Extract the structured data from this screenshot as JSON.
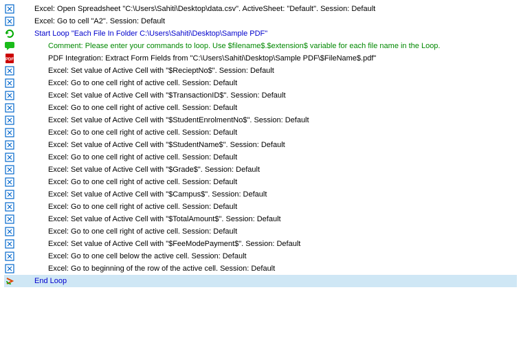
{
  "lines": [
    {
      "icon": "excel",
      "indent": 1,
      "color": "black",
      "text": "Excel: Open Spreadsheet \"C:\\Users\\Sahiti\\Desktop\\data.csv\". ActiveSheet: \"Default\". Session: Default"
    },
    {
      "icon": "excel",
      "indent": 1,
      "color": "black",
      "text": "Excel: Go to cell \"A2\". Session: Default"
    },
    {
      "icon": "loop-start",
      "indent": 1,
      "color": "blue",
      "text": "Start Loop \"Each File In Folder C:\\Users\\Sahiti\\Desktop\\Sample PDF\""
    },
    {
      "icon": "comment",
      "indent": 2,
      "color": "green",
      "text": "Comment: Please enter your commands to loop. Use $filename$.$extension$ variable for each file name in the Loop."
    },
    {
      "icon": "pdf",
      "indent": 2,
      "color": "black",
      "text": "PDF Integration: Extract Form Fields from \"C:\\Users\\Sahiti\\Desktop\\Sample PDF\\$FileName$.pdf\""
    },
    {
      "icon": "excel",
      "indent": 2,
      "color": "black",
      "text": "Excel: Set value of Active Cell with \"$RecieptNo$\". Session: Default"
    },
    {
      "icon": "excel",
      "indent": 2,
      "color": "black",
      "text": "Excel: Go to one cell right of active cell. Session: Default"
    },
    {
      "icon": "excel",
      "indent": 2,
      "color": "black",
      "text": "Excel: Set value of Active Cell with \"$TransactionID$\". Session: Default"
    },
    {
      "icon": "excel",
      "indent": 2,
      "color": "black",
      "text": "Excel: Go to one cell right of active cell. Session: Default"
    },
    {
      "icon": "excel",
      "indent": 2,
      "color": "black",
      "text": "Excel: Set value of Active Cell with \"$StudentEnrolmentNo$\". Session: Default"
    },
    {
      "icon": "excel",
      "indent": 2,
      "color": "black",
      "text": "Excel: Go to one cell right of active cell. Session: Default"
    },
    {
      "icon": "excel",
      "indent": 2,
      "color": "black",
      "text": "Excel: Set value of Active Cell with \"$StudentName$\". Session: Default"
    },
    {
      "icon": "excel",
      "indent": 2,
      "color": "black",
      "text": "Excel: Go to one cell right of active cell. Session: Default"
    },
    {
      "icon": "excel",
      "indent": 2,
      "color": "black",
      "text": "Excel: Set value of Active Cell with \"$Grade$\". Session: Default"
    },
    {
      "icon": "excel",
      "indent": 2,
      "color": "black",
      "text": "Excel: Go to one cell right of active cell. Session: Default"
    },
    {
      "icon": "excel",
      "indent": 2,
      "color": "black",
      "text": "Excel: Set value of Active Cell with \"$Campus$\". Session: Default"
    },
    {
      "icon": "excel",
      "indent": 2,
      "color": "black",
      "text": "Excel: Go to one cell right of active cell. Session: Default"
    },
    {
      "icon": "excel",
      "indent": 2,
      "color": "black",
      "text": "Excel: Set value of Active Cell with \"$TotalAmount$\". Session: Default"
    },
    {
      "icon": "excel",
      "indent": 2,
      "color": "black",
      "text": "Excel: Go to one cell right of active cell. Session: Default"
    },
    {
      "icon": "excel",
      "indent": 2,
      "color": "black",
      "text": "Excel: Set value of Active Cell with \"$FeeModePayment$\". Session: Default"
    },
    {
      "icon": "excel",
      "indent": 2,
      "color": "black",
      "text": "Excel: Go to one cell below the active cell. Session: Default"
    },
    {
      "icon": "excel",
      "indent": 2,
      "color": "black",
      "text": "Excel: Go to beginning of the row of the active cell. Session: Default"
    },
    {
      "icon": "loop-end",
      "indent": 1,
      "color": "blue",
      "text": "End Loop",
      "highlight": true
    }
  ]
}
